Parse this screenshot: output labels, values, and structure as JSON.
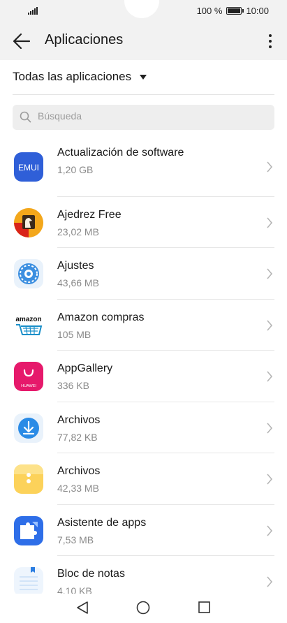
{
  "status": {
    "battery_text": "100 %",
    "time": "10:00"
  },
  "header": {
    "title": "Aplicaciones"
  },
  "filter": {
    "label": "Todas las aplicaciones"
  },
  "search": {
    "placeholder": "Búsqueda"
  },
  "apps": [
    {
      "name": "Actualización de software",
      "size": "1,20 GB",
      "icon": "emui-icon",
      "logo_text": "EMUI"
    },
    {
      "name": "Ajedrez Free",
      "size": "23,02 MB",
      "icon": "chess-icon"
    },
    {
      "name": "Ajustes",
      "size": "43,66 MB",
      "icon": "settings-gear-icon"
    },
    {
      "name": "Amazon compras",
      "size": "105 MB",
      "icon": "amazon-cart-icon",
      "logo_text": "amazon"
    },
    {
      "name": "AppGallery",
      "size": "336 KB",
      "icon": "appgallery-bag-icon",
      "logo_text": "HUAWEI"
    },
    {
      "name": "Archivos",
      "size": "77,82 KB",
      "icon": "download-arrow-icon"
    },
    {
      "name": "Archivos",
      "size": "42,33 MB",
      "icon": "files-folder-icon"
    },
    {
      "name": "Asistente de apps",
      "size": "7,53 MB",
      "icon": "puzzle-icon"
    },
    {
      "name": "Bloc de notas",
      "size": "4,10 KB",
      "icon": "notepad-icon"
    }
  ],
  "colors": {
    "bar_background": "#f2f2f2",
    "separator": "#e6e6e6",
    "secondary_text": "#8a8a8a"
  }
}
